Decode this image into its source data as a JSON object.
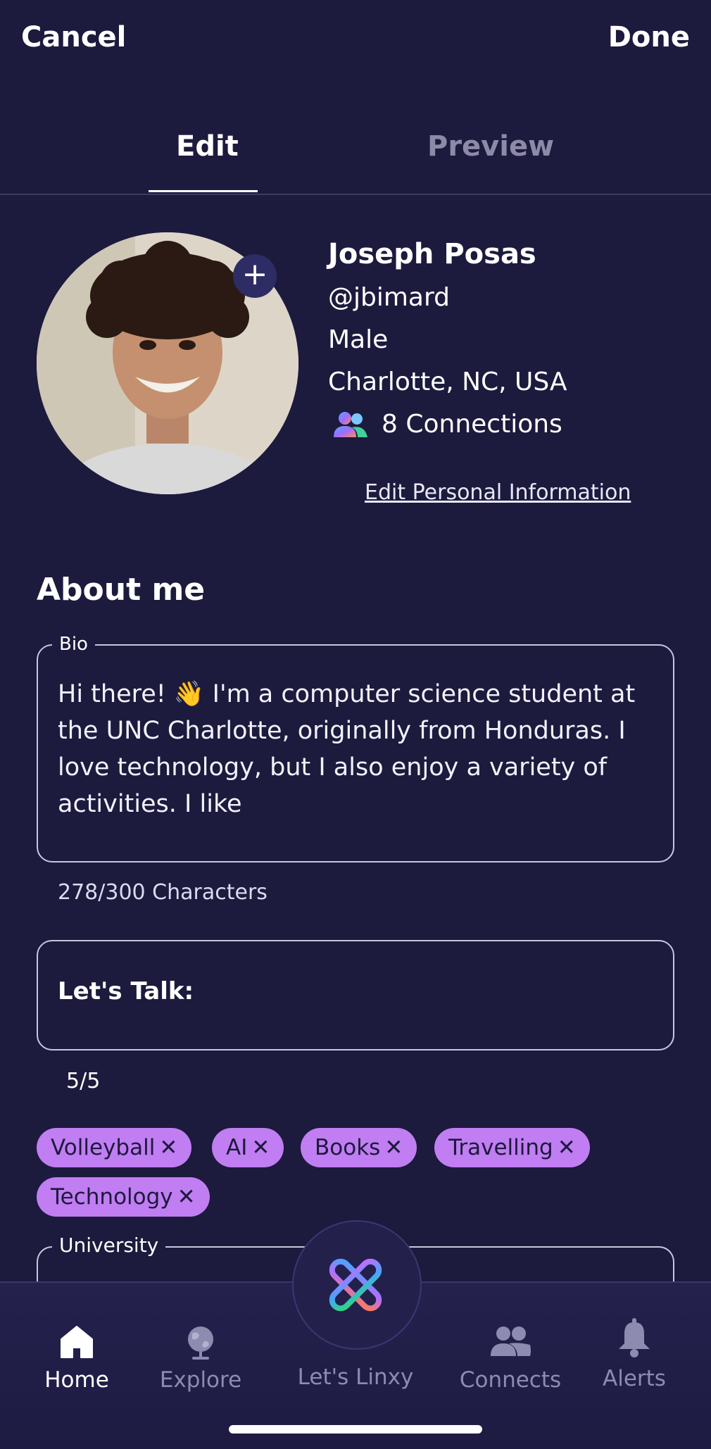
{
  "topbar": {
    "cancel_label": "Cancel",
    "done_label": "Done"
  },
  "tabs": [
    {
      "label": "Edit",
      "active": true
    },
    {
      "label": "Preview",
      "active": false
    }
  ],
  "profile": {
    "name": "Joseph  Posas",
    "handle": "@jbimard",
    "gender": "Male",
    "location": "Charlotte, NC, USA",
    "connections": "8 Connections",
    "edit_link": "Edit Personal Information",
    "avatar_add_icon": "plus-icon"
  },
  "about": {
    "heading": "About me",
    "bio_legend": "Bio",
    "bio_text": "Hi there! 👋  I'm a computer science student at the UNC Charlotte, originally from Honduras. I love technology, but I also enjoy a variety of activities. I like",
    "bio_count": "278/300 Characters",
    "talk_label": "Let's Talk:",
    "talk_count": "5/5"
  },
  "interests": [
    {
      "label": "Volleyball"
    },
    {
      "label": "AI"
    },
    {
      "label": "Books"
    },
    {
      "label": "Travelling"
    },
    {
      "label": "Technology"
    }
  ],
  "university": {
    "legend": "University"
  },
  "nav": [
    {
      "label": "Home",
      "icon": "home-icon",
      "active": true
    },
    {
      "label": "Explore",
      "icon": "globe-icon",
      "active": false
    },
    {
      "label": "Let's Linxy",
      "icon": "linxy-logo-icon",
      "active": false
    },
    {
      "label": "Connects",
      "icon": "people-icon",
      "active": false
    },
    {
      "label": "Alerts",
      "icon": "bell-icon",
      "active": false
    }
  ],
  "colors": {
    "background": "#1c1a3d",
    "chip": "#c17df2",
    "accent": "#2e2c64",
    "muted": "#8e8bb0"
  }
}
